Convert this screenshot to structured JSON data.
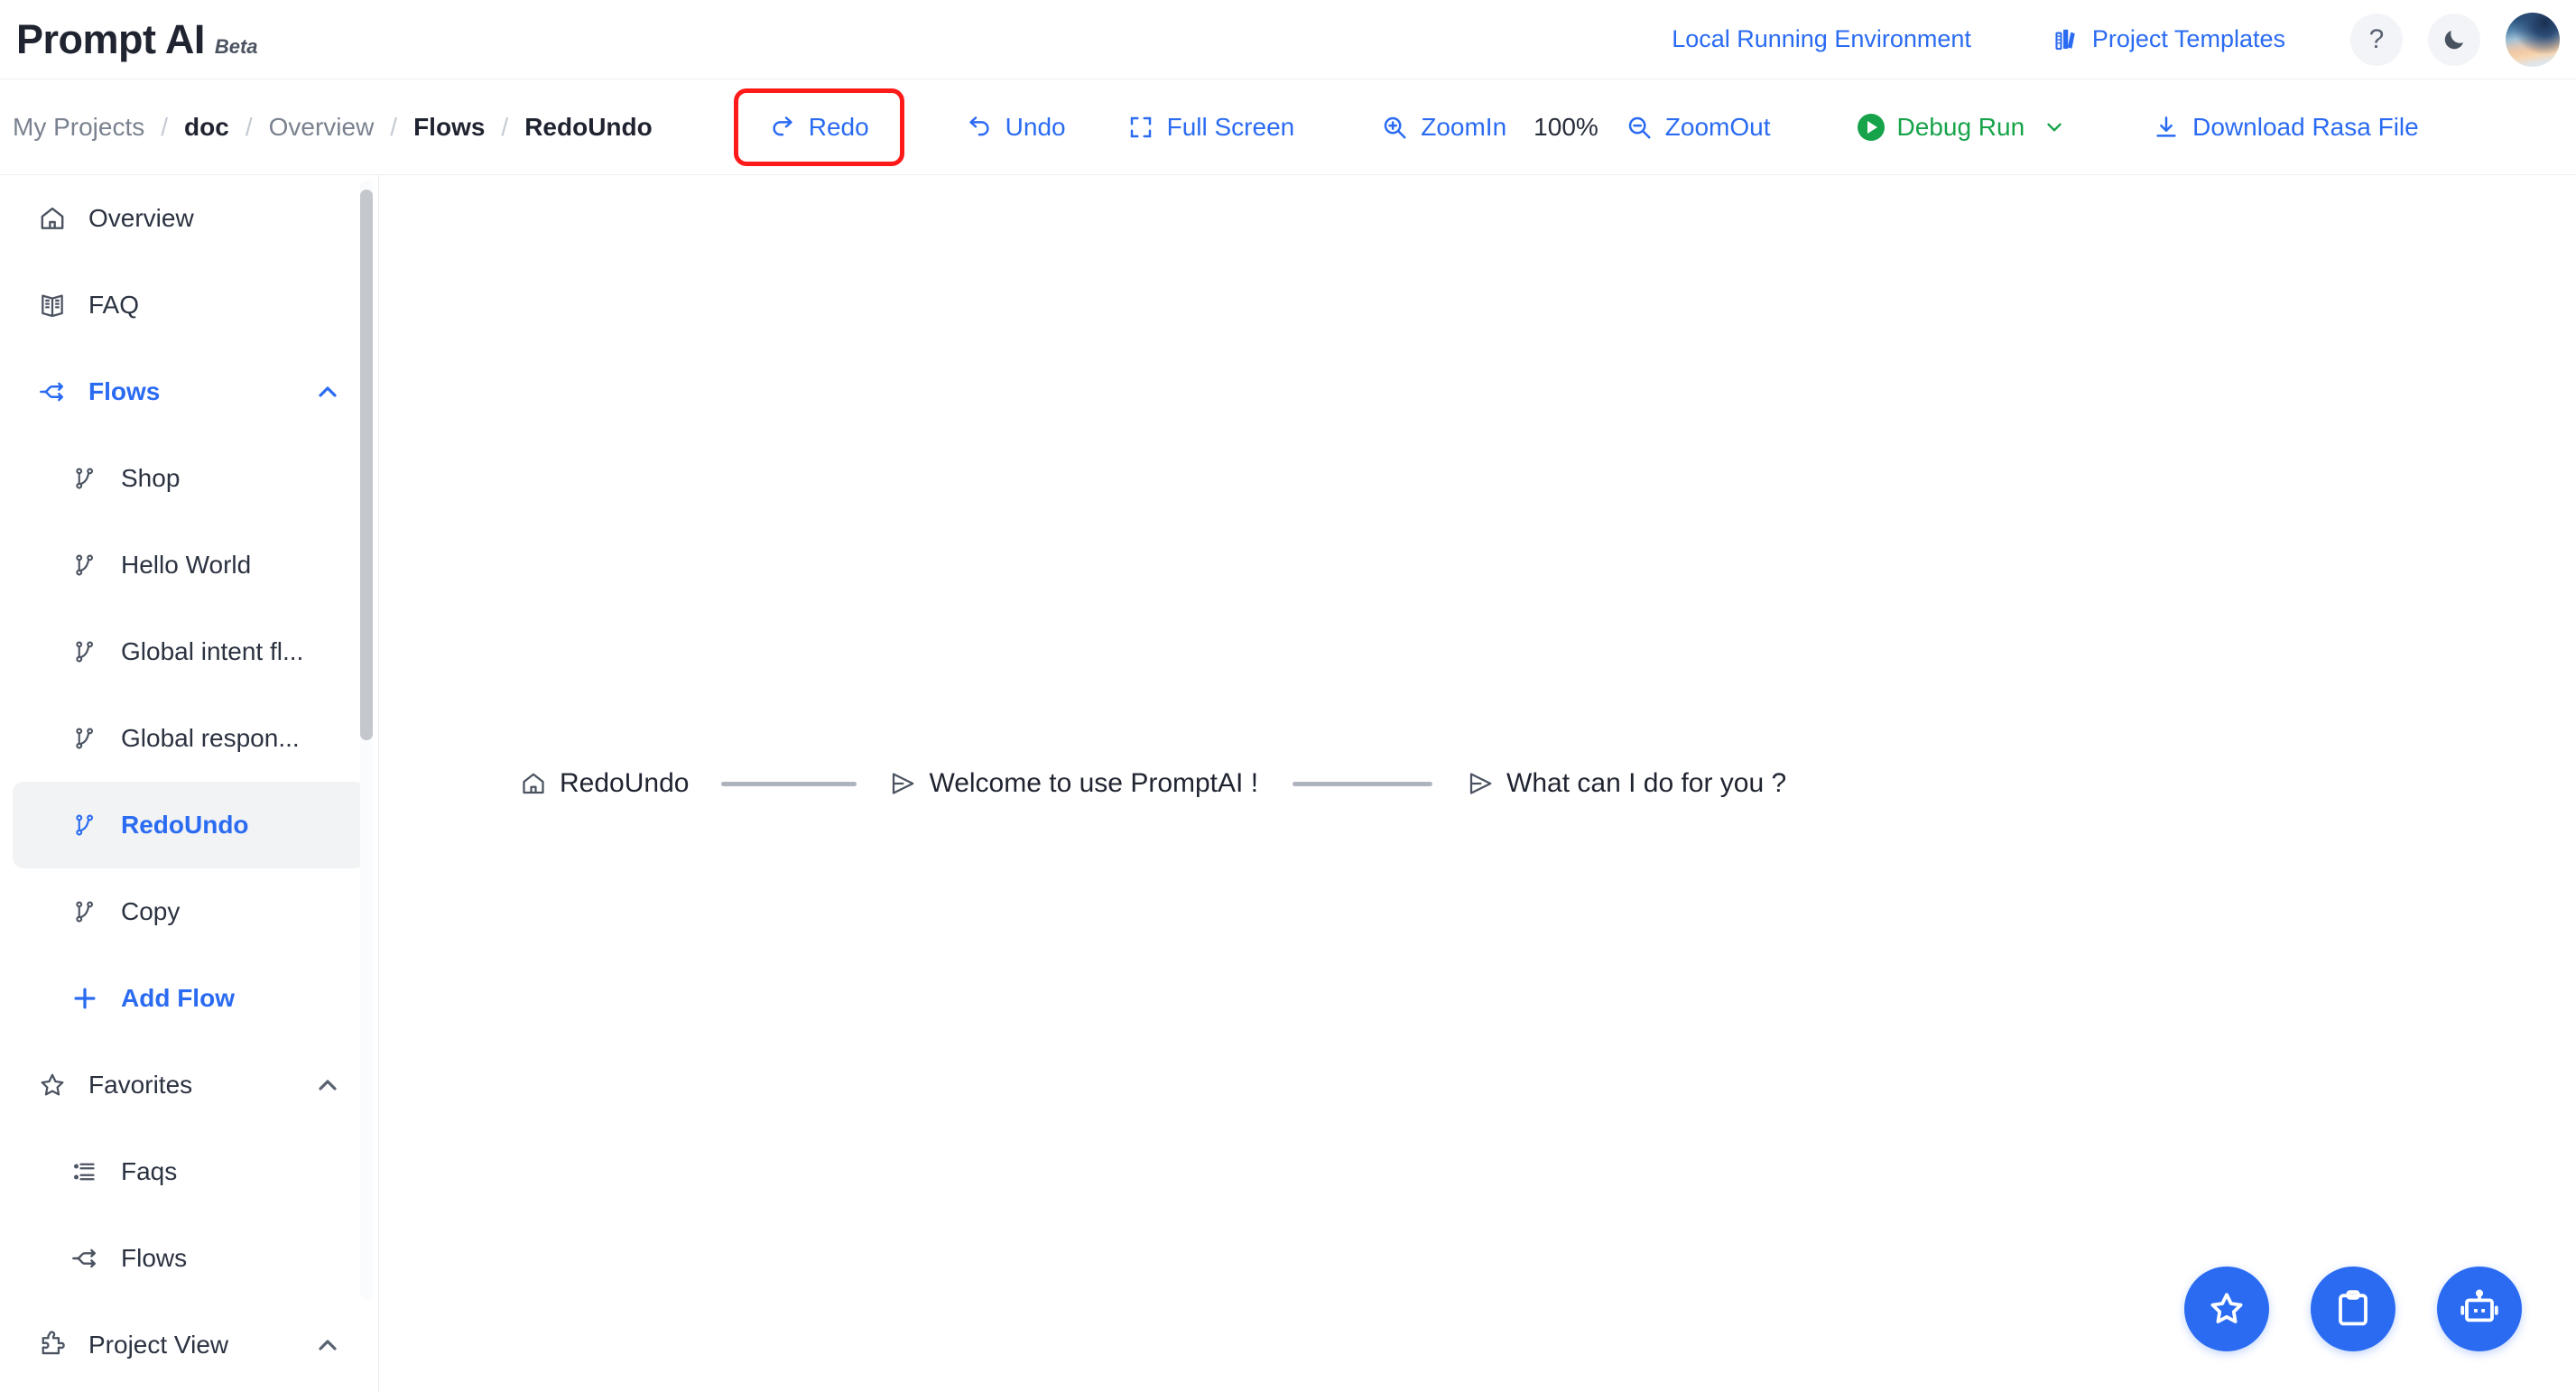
{
  "header": {
    "brand_name": "Prompt AI",
    "brand_beta": "Beta",
    "local_env_label": "Local Running Environment",
    "project_templates_label": "Project Templates",
    "templates_icon": "books-icon",
    "help_icon": "?",
    "theme_icon": "moon-icon",
    "avatar_icon": "user-avatar"
  },
  "toolbar": {
    "breadcrumb": [
      {
        "label": "My Projects",
        "strong": false
      },
      {
        "label": "doc",
        "strong": true
      },
      {
        "label": "Overview",
        "strong": false
      },
      {
        "label": "Flows",
        "strong": true
      },
      {
        "label": "RedoUndo",
        "strong": true
      }
    ],
    "separator": "/",
    "redo_label": "Redo",
    "undo_label": "Undo",
    "fullscreen_label": "Full Screen",
    "zoomin_label": "ZoomIn",
    "zoom_level": "100%",
    "zoomout_label": "ZoomOut",
    "debug_run_label": "Debug Run",
    "download_label": "Download Rasa File",
    "highlight_color": "#ff1a1a",
    "accent_color": "#2a6bf2",
    "run_color": "#16a34a"
  },
  "sidebar": {
    "items": [
      {
        "label": "Overview",
        "icon": "home-icon",
        "level": 0,
        "state": "normal"
      },
      {
        "label": "FAQ",
        "icon": "book-icon",
        "level": 0,
        "state": "normal"
      },
      {
        "label": "Flows",
        "icon": "flow-icon",
        "level": 0,
        "state": "blue",
        "chevron": "up"
      },
      {
        "label": "Shop",
        "icon": "branch-icon",
        "level": 1,
        "state": "normal"
      },
      {
        "label": "Hello World",
        "icon": "branch-icon",
        "level": 1,
        "state": "normal"
      },
      {
        "label": "Global intent fl...",
        "icon": "branch-icon",
        "level": 1,
        "state": "normal"
      },
      {
        "label": "Global respon...",
        "icon": "branch-icon",
        "level": 1,
        "state": "normal"
      },
      {
        "label": "RedoUndo",
        "icon": "branch-icon",
        "level": 1,
        "state": "active"
      },
      {
        "label": "Copy",
        "icon": "branch-icon",
        "level": 1,
        "state": "normal"
      },
      {
        "label": "Add Flow",
        "icon": "plus-icon",
        "level": 1,
        "state": "addflow"
      },
      {
        "label": "Favorites",
        "icon": "star-icon",
        "level": 0,
        "state": "normal",
        "chevron": "up-grey"
      },
      {
        "label": "Faqs",
        "icon": "list-icon",
        "level": 1,
        "state": "normal"
      },
      {
        "label": "Flows",
        "icon": "flow-icon",
        "level": 1,
        "state": "normal"
      },
      {
        "label": "Project View",
        "icon": "puzzle-icon",
        "level": 0,
        "state": "normal",
        "chevron": "up-grey"
      }
    ]
  },
  "canvas": {
    "nodes": [
      {
        "label": "RedoUndo",
        "icon": "home-icon"
      },
      {
        "label": "Welcome to use PromptAI !",
        "icon": "send-icon"
      },
      {
        "label": "What can I do for you ?",
        "icon": "send-icon"
      }
    ],
    "edge_color": "#aeb4bd"
  },
  "fabs": [
    {
      "name": "favorites-fab",
      "icon": "star-icon"
    },
    {
      "name": "clipboard-fab",
      "icon": "clipboard-icon"
    },
    {
      "name": "bot-fab",
      "icon": "robot-icon"
    }
  ]
}
